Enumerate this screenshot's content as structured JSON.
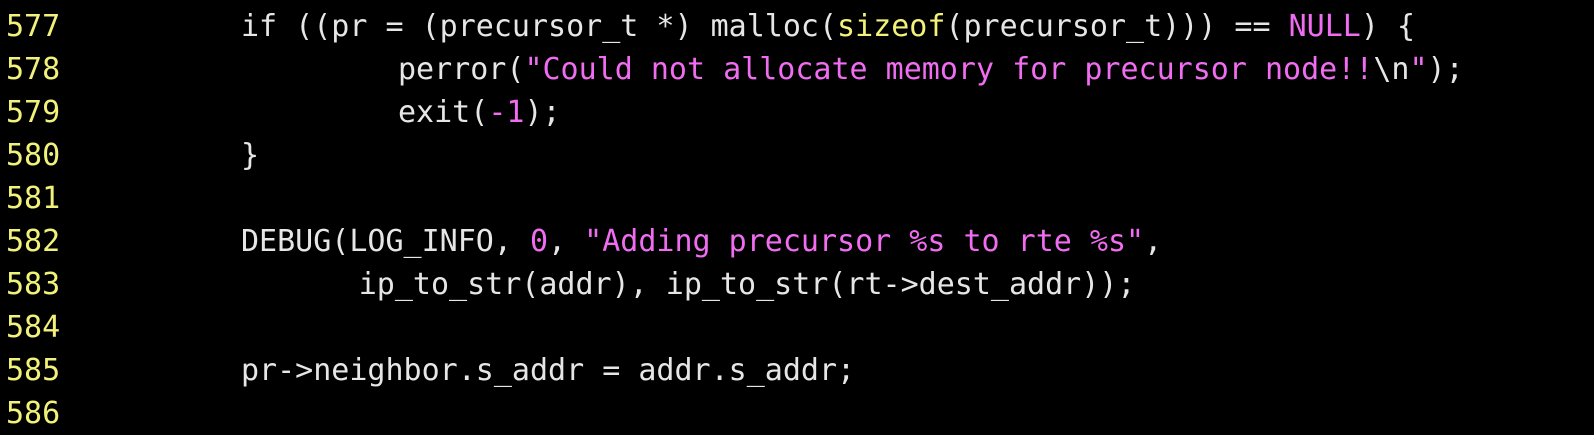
{
  "editor": {
    "colors": {
      "background": "#000000",
      "line_number": "#f2f27a",
      "default_text": "#e6e6e6",
      "keyword": "#f2f27a",
      "string_literal": "#f06cf0",
      "number_literal": "#f06cf0"
    },
    "lines": [
      {
        "number": "577",
        "indent": 2,
        "tokens": [
          {
            "t": "if ((pr = (precursor_t *) malloc(",
            "k": "default"
          },
          {
            "t": "sizeof",
            "k": "keyword"
          },
          {
            "t": "(precursor_t))) == ",
            "k": "default"
          },
          {
            "t": "NULL",
            "k": "string"
          },
          {
            "t": ") {",
            "k": "default"
          }
        ]
      },
      {
        "number": "578",
        "indent": 4,
        "tokens": [
          {
            "t": "perror(",
            "k": "default"
          },
          {
            "t": "\"Could not allocate memory for precursor node!!",
            "k": "string"
          },
          {
            "t": "\\n",
            "k": "default"
          },
          {
            "t": "\"",
            "k": "string"
          },
          {
            "t": ");",
            "k": "default"
          }
        ]
      },
      {
        "number": "579",
        "indent": 4,
        "tokens": [
          {
            "t": "exit(",
            "k": "default"
          },
          {
            "t": "-1",
            "k": "number"
          },
          {
            "t": ");",
            "k": "default"
          }
        ]
      },
      {
        "number": "580",
        "indent": 2,
        "tokens": [
          {
            "t": "}",
            "k": "default"
          }
        ]
      },
      {
        "number": "581",
        "indent": 2,
        "tokens": []
      },
      {
        "number": "582",
        "indent": 2,
        "tokens": [
          {
            "t": "DEBUG(LOG_INFO, ",
            "k": "default"
          },
          {
            "t": "0",
            "k": "number"
          },
          {
            "t": ", ",
            "k": "default"
          },
          {
            "t": "\"Adding precursor %s to rte %s\"",
            "k": "string"
          },
          {
            "t": ",",
            "k": "default"
          }
        ]
      },
      {
        "number": "583",
        "indent": 3.5,
        "tokens": [
          {
            "t": "ip_to_str(addr), ip_to_str(rt->dest_addr));",
            "k": "default"
          }
        ]
      },
      {
        "number": "584",
        "indent": 2,
        "tokens": []
      },
      {
        "number": "585",
        "indent": 2,
        "tokens": [
          {
            "t": "pr->neighbor.s_addr = addr.s_addr;",
            "k": "default"
          }
        ]
      },
      {
        "number": "586",
        "indent": 2,
        "tokens": []
      }
    ]
  }
}
